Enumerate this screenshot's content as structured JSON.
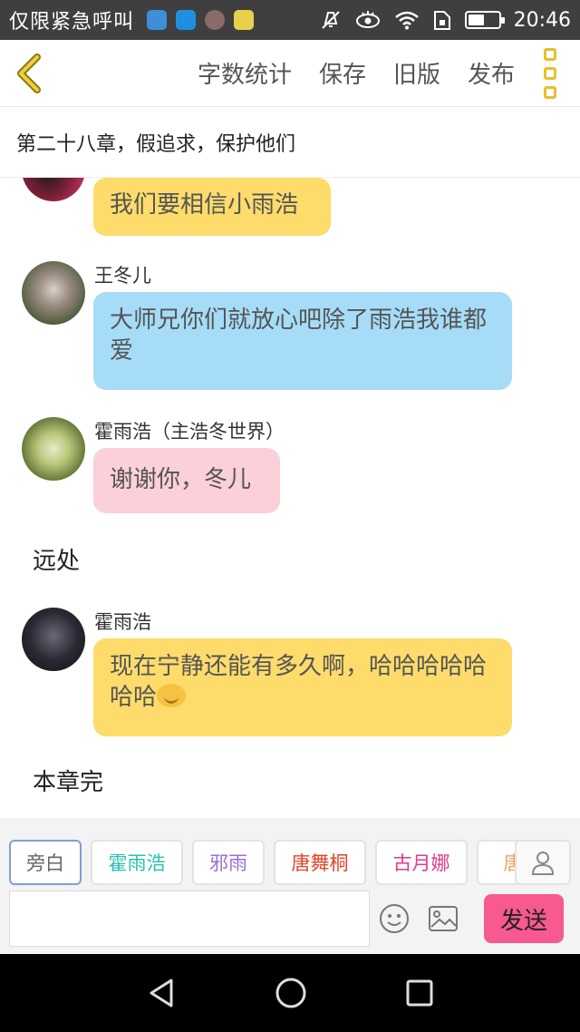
{
  "status_bar": {
    "left_text": "仅限紧急呼叫",
    "time": "20:46",
    "battery_level": 0.55
  },
  "toolbar": {
    "word_count_label": "字数统计",
    "save_label": "保存",
    "old_version_label": "旧版",
    "publish_label": "发布"
  },
  "chapter": {
    "title": "第二十八章，假追求，保护他们"
  },
  "messages": [
    {
      "speaker": "",
      "text": "我们要相信小雨浩",
      "bubble_color": "#fddc6b"
    },
    {
      "speaker": "王冬儿",
      "text": "大师兄你们就放心吧除了雨浩我谁都爱",
      "bubble_color": "#a6dcf7"
    },
    {
      "speaker": "霍雨浩（主浩冬世界）",
      "text": "谢谢你，冬儿",
      "bubble_color": "#fbd0d8"
    },
    {
      "narration": "远处"
    },
    {
      "speaker": "霍雨浩",
      "text": "现在宁静还能有多久啊，哈哈哈哈哈哈哈",
      "bubble_color": "#fddc6b"
    },
    {
      "narration": "本章完"
    }
  ],
  "roles": [
    {
      "label": "旁白",
      "color": "#666666",
      "active": true
    },
    {
      "label": "霍雨浩",
      "color": "#2bbfb0"
    },
    {
      "label": "邪雨",
      "color": "#9b6fd6"
    },
    {
      "label": "唐舞桐",
      "color": "#e0452b"
    },
    {
      "label": "古月娜",
      "color": "#e03a8c"
    },
    {
      "label": "唐",
      "color": "#f0a060"
    }
  ],
  "input": {
    "value": "",
    "placeholder": "",
    "send_label": "发送"
  }
}
